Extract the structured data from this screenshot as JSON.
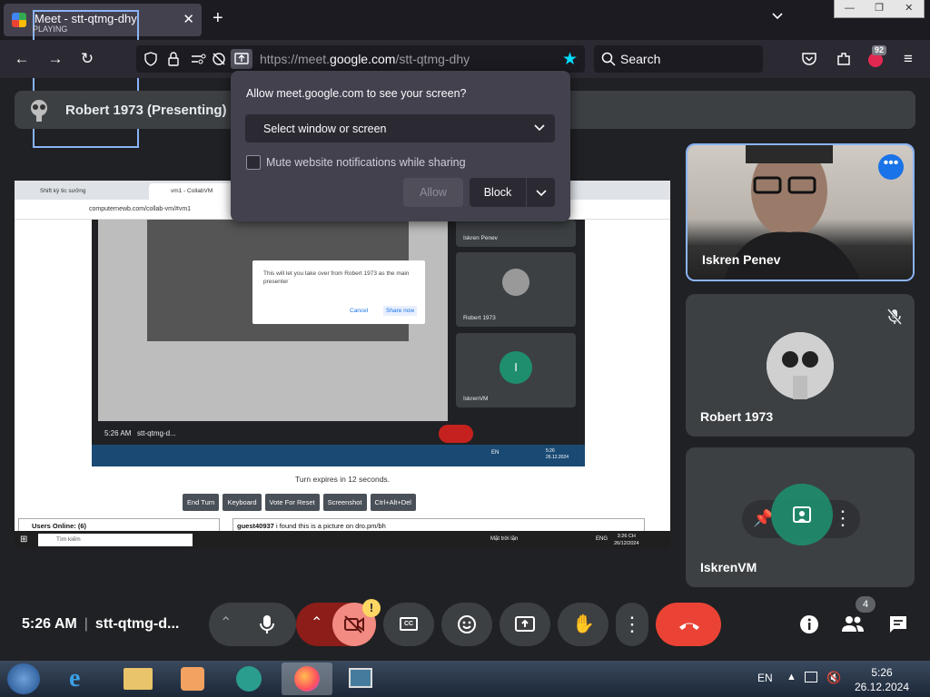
{
  "browser": {
    "tab_title": "Meet - stt-qtmg-dhy",
    "tab_status": "PLAYING",
    "new_tab": "+",
    "url_prefix": "https://meet.",
    "url_domain": "google.com",
    "url_path": "/stt-qtmg-dhy",
    "search_placeholder": "Search",
    "extension_badge": "92"
  },
  "presenting_bar": {
    "label": "Robert 1973 (Presenting)"
  },
  "permission_popup": {
    "heading": "Allow meet.google.com to see your screen?",
    "select_value": "Select window or screen",
    "mute_label": "Mute website notifications while sharing",
    "allow": "Allow",
    "block": "Block"
  },
  "shared_screen": {
    "tab1": "Shift kỳ tic sưởng",
    "tab2": "vm1 - CollabVM",
    "address": "computernewb.com/collab-vm/#vm1",
    "dialog_text": "This will let you take over from Robert 1973 as the main presenter",
    "dialog_cancel": "Cancel",
    "dialog_share": "Share now",
    "tile1": "Iskren Penev",
    "tile2": "Robert 1973",
    "tile3": "IskrenVM",
    "tile3_initial": "I",
    "vm_time": "5:26 AM",
    "vm_code": "stt-qtmg-d...",
    "vm_lang": "EN",
    "vm_clock": "5:26\n26.12.2024",
    "turn_text": "Turn expires in 12 seconds.",
    "buttons": [
      "End Turn",
      "Keyboard",
      "Vote For Reset",
      "Screenshot",
      "Ctrl+Alt+Del"
    ],
    "users_online": "Users Online: (6)",
    "chat_user": "guest40937",
    "chat_text": " i found this is a picture on dro.pm/bh",
    "search_box": "Tìm kiếm",
    "weather": "Mặt trời lặn",
    "lang": "ENG",
    "clock": "3:26 CH\n26/12/2024"
  },
  "participants": [
    {
      "name": "Iskren Penev",
      "action": "•••"
    },
    {
      "name": "Robert 1973"
    },
    {
      "name": "IskrenVM"
    }
  ],
  "meet_controls": {
    "time": "5:26 AM",
    "separator": "|",
    "meeting_code": "stt-qtmg-d...",
    "camera_warning": "!",
    "people_count": "4"
  },
  "taskbar": {
    "lang": "EN",
    "time": "5:26",
    "date": "26.12.2024"
  },
  "colors": {
    "meet_bg": "#202124",
    "end_call": "#ea4335",
    "camera_off": "#f28b82",
    "accent_blue": "#8ab4f8",
    "firefox_star": "#00ddff"
  }
}
